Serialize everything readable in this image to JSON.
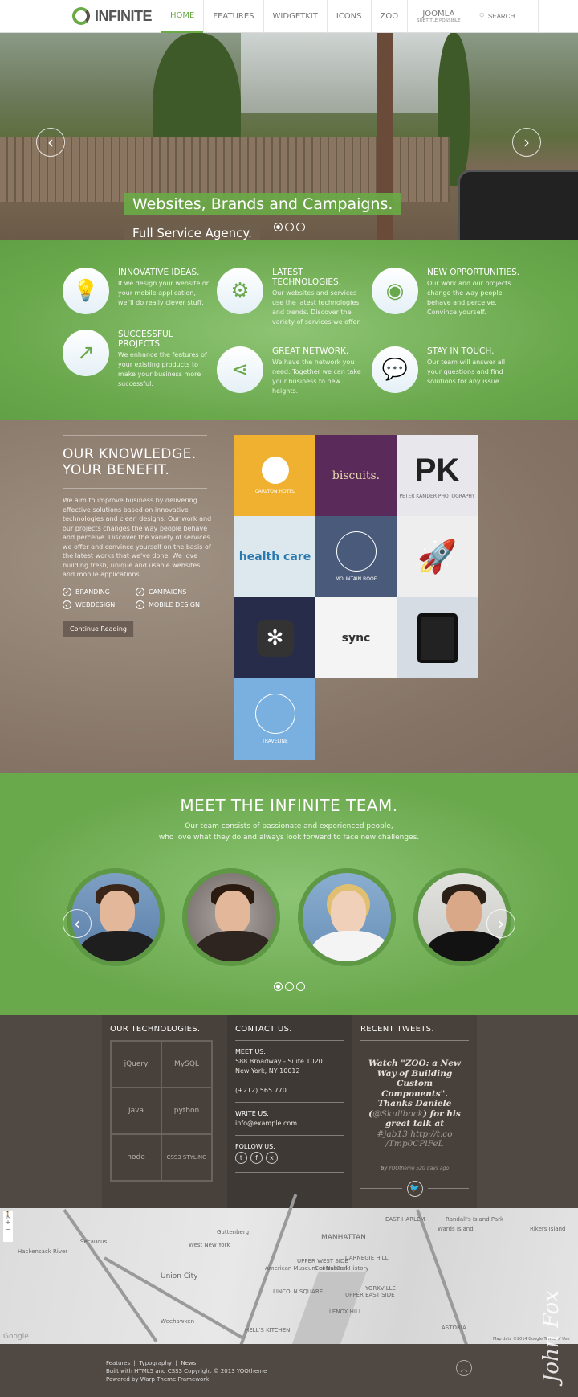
{
  "header": {
    "logo": "INFINITE",
    "nav": [
      {
        "label": "HOME",
        "active": true
      },
      {
        "label": "FEATURES"
      },
      {
        "label": "WIDGETKIT"
      },
      {
        "label": "ICONS"
      },
      {
        "label": "ZOO"
      },
      {
        "label": "JOOMLA",
        "subtitle": "SUBTITLE POSSIBLE"
      }
    ],
    "search_placeholder": "SEARCH..."
  },
  "hero": {
    "title": "Websites, Brands and Campaigns.",
    "subtitle": "Full Service Agency.",
    "slides": 3,
    "active_slide": 1
  },
  "features": [
    {
      "icon": "lightbulb-icon",
      "glyph": "💡",
      "title": "INNOVATIVE IDEAS.",
      "text": "If we design your website or your mobile application, we\"ll do really clever stuff."
    },
    {
      "icon": "gears-icon",
      "glyph": "⚙",
      "title": "LATEST TECHNOLOGIES.",
      "text": "Our websites and services use the latest technologies and trends. Discover the variety of services we offer."
    },
    {
      "icon": "eye-icon",
      "glyph": "◉",
      "title": "NEW OPPORTUNITIES.",
      "text": "Our work and our projects change the way people behave and perceive. Convince yourself."
    },
    {
      "icon": "trend-chart-icon",
      "glyph": "↗",
      "title": "SUCCESSFUL PROJECTS.",
      "text": "We enhance the features of your existing products to make your business more successful."
    },
    {
      "icon": "share-icon",
      "glyph": "⋖",
      "title": "GREAT NETWORK.",
      "text": "We have the network you need. Together we can take your business to new heights."
    },
    {
      "icon": "chat-bubbles-icon",
      "glyph": "💬",
      "title": "STAY IN TOUCH.",
      "text": "Our team will answer all your questions and find solutions for any issue."
    }
  ],
  "knowledge": {
    "heading": "OUR KNOWLEDGE. YOUR BENEFIT.",
    "text": "We aim to improve business by delivering effective solutions based on innovative technologies and clean designs. Our work and our projects changes the way people behave and perceive. Discover the variety of services we offer and convince yourself on the basis of the latest works that we've done. We love building fresh, unique and usable websites and mobile applications.",
    "checklist": [
      "BRANDING",
      "CAMPAIGNS",
      "WEBDESIGN",
      "MOBILE DESIGN"
    ],
    "button": "Continue Reading"
  },
  "portfolio": [
    {
      "label": "CARLTON HOTEL",
      "bg": "#f0b030"
    },
    {
      "label": "biscuits.",
      "bg": "#5a2a5a"
    },
    {
      "label": "PETER KAMDER PHOTOGRAPHY",
      "bg": "#e8e8ec",
      "mark": "PK"
    },
    {
      "label": "health care",
      "bg": "#dce8ee"
    },
    {
      "label": "MOUNTAIN ROOF",
      "bg": "#4a5a7a"
    },
    {
      "label": "",
      "bg": "#eeeeee"
    },
    {
      "label": "",
      "bg": "#262c4a"
    },
    {
      "label": "sync",
      "bg": "#f4f4f4"
    },
    {
      "label": "",
      "bg": "#d6dce4"
    },
    {
      "label": "TRAVELINE",
      "bg": "#7ab0e0"
    }
  ],
  "team": {
    "title": "MEET THE INFINITE TEAM.",
    "subtitle_1": "Our team consists of passionate and experienced people,",
    "subtitle_2": "who love what they do and always look forward to face new challenges.",
    "slides": 3,
    "active_slide": 1
  },
  "footer": {
    "tech_title": "OUR TECHNOLOGIES.",
    "tech": [
      "jQuery",
      "MySQL",
      "Java",
      "python",
      "node",
      "CSS3 STYLING"
    ],
    "contact_title": "CONTACT US.",
    "meet_label": "MEET US.",
    "address_1": "588 Broadway - Suite 1020",
    "address_2": "New York, NY 10012",
    "phone": "(+212) 565 770",
    "write_label": "WRITE US.",
    "email": "info@example.com",
    "follow_label": "FOLLOW US.",
    "tweets_title": "RECENT TWEETS.",
    "tweet_a": "Watch \"ZOO: a New Way of Building Custom Components\". Thanks Daniele (",
    "tweet_handle": "@Skullbock",
    "tweet_b": ") for his great talk at ",
    "tweet_link": "#jab13 http://t.co /Tmp0CPlFeL",
    "tweet_by": "by",
    "tweet_author": "YOOtheme 520 days ago"
  },
  "map": {
    "labels": [
      "Hackensack River",
      "Secaucus",
      "West New York",
      "Guttenberg",
      "Union City",
      "Weehawken",
      "MANHATTAN",
      "UPPER WEST SIDE",
      "Central Park",
      "American Museum of Natural History",
      "LINCOLN SQUARE",
      "UPPER EAST SIDE",
      "YORKVILLE",
      "HELL'S KITCHEN",
      "EAST HARLEM",
      "Randall's Island Park",
      "Wards Island",
      "Rikers Island",
      "ASTORIA",
      "CARNEGIE HILL",
      "LENOX HILL"
    ],
    "attribution": "Map data ©2014 Google   Terms of Use",
    "google": "Google"
  },
  "bottom": {
    "links": [
      "Features",
      "Typography",
      "News"
    ],
    "copyright": "Built with HTML5 and CSS3 Copyright © 2013 YOOtheme",
    "powered": "Powered by Warp Theme Framework"
  },
  "watermark": "John Fox CREATIVE"
}
